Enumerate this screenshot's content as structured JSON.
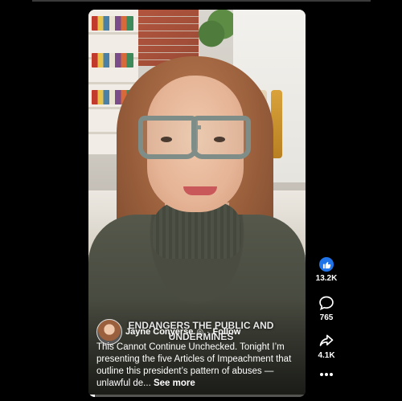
{
  "post": {
    "overlay_caption": "ENDANGERS THE PUBLIC AND UNDERMINES",
    "author_name": "Jayne Conyerse",
    "verified_icon": "◎",
    "follow_label": "Follow",
    "description": "This Cannot Continue Unchecked. Tonight I’m presenting the five Articles of Impeachment that outline this president’s pattern of abuses — unlawful de...",
    "see_more_label": "See more",
    "progress": 0.03
  },
  "actions": {
    "likes": "13.2K",
    "comments": "765",
    "shares": "4.1K"
  },
  "icons": [
    "like-icon",
    "comment-icon",
    "share-icon",
    "more-icon",
    "verified-icon"
  ],
  "colors": {
    "like_blue": "#1f74ea",
    "background": "#000000"
  }
}
